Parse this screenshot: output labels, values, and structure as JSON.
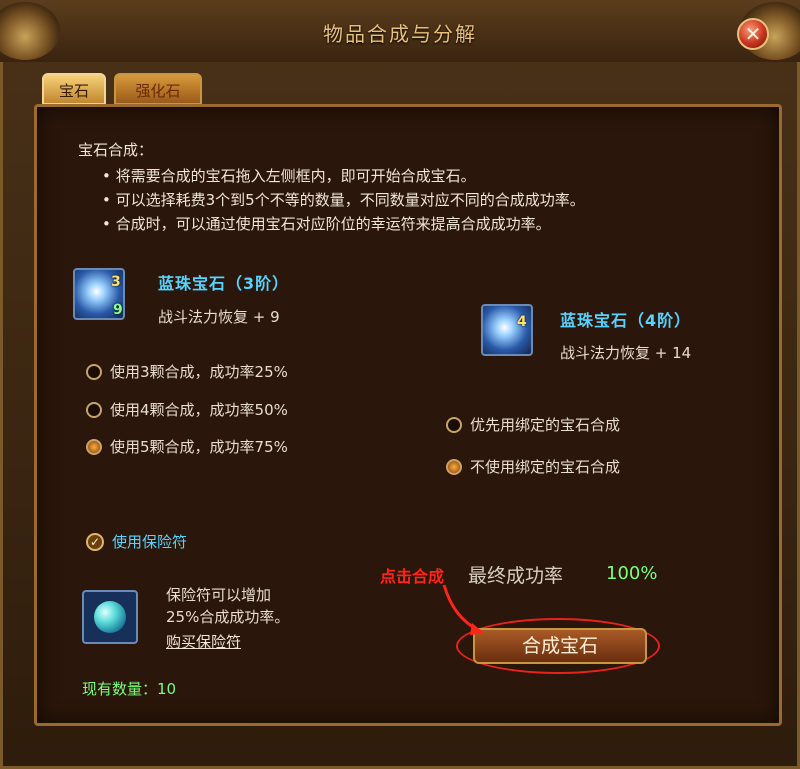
{
  "window": {
    "title": "物品合成与分解",
    "close_label": "✕"
  },
  "tabs": [
    {
      "label": "宝石",
      "active": true
    },
    {
      "label": "强化石",
      "active": false
    }
  ],
  "intro": {
    "heading": "宝石合成：",
    "bullets": [
      "• 将需要合成的宝石拖入左侧框内，即可开始合成宝石。",
      "• 可以选择耗费3个到5个不等的数量，不同数量对应不同的合成成功率。",
      "• 合成时，可以通过使用宝石对应阶位的幸运符来提高合成成功率。"
    ]
  },
  "source_gem": {
    "icon": "blue-gem-icon",
    "tier_badge": "3",
    "count_badge": "9",
    "name": "蓝珠宝石（3阶）",
    "effect": "战斗法力恢复 + 9"
  },
  "result_gem": {
    "icon": "blue-gem-icon",
    "tier_badge": "4",
    "name": "蓝珠宝石（4阶）",
    "effect": "战斗法力恢复 + 14"
  },
  "quantity_options": [
    {
      "label": "使用3颗合成，成功率25%",
      "selected": false
    },
    {
      "label": "使用4颗合成，成功率50%",
      "selected": false
    },
    {
      "label": "使用5颗合成，成功率75%",
      "selected": true
    }
  ],
  "bind_options": [
    {
      "label": "优先用绑定的宝石合成",
      "selected": false
    },
    {
      "label": "不使用绑定的宝石合成",
      "selected": true
    }
  ],
  "insurance": {
    "checkbox_label": "使用保险符",
    "checked": true,
    "desc_line1": "保险符可以增加",
    "desc_line2": "25%合成成功率。",
    "buy_link": "购买保险符",
    "owned": "现有数量：10"
  },
  "final": {
    "label": "最终成功率",
    "value": "100%"
  },
  "combine_button": "合成宝石",
  "annotation": "点击合成",
  "colors": {
    "gem_name": "#56d4ff",
    "success_green": "#7aff7a",
    "annotation_red": "#ff2418"
  }
}
